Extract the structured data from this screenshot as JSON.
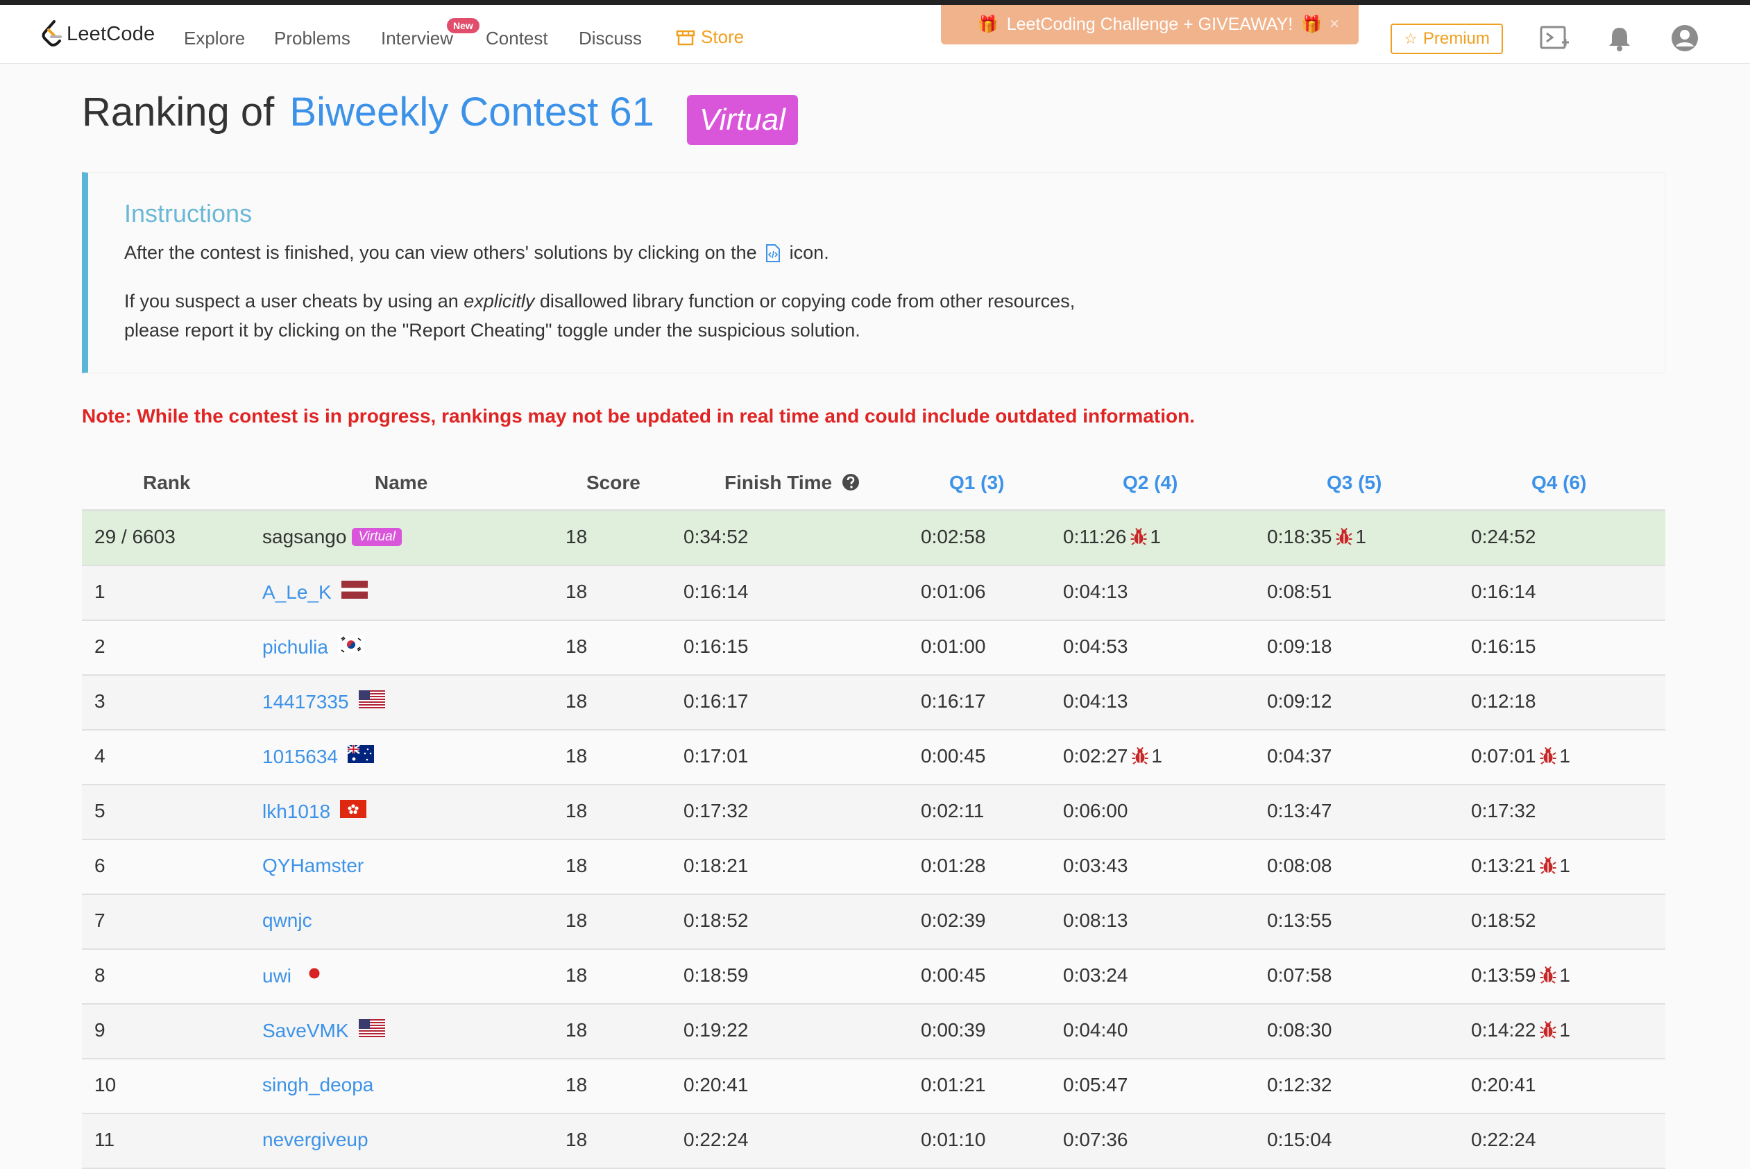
{
  "nav": {
    "brand": "LeetCode",
    "links": [
      "Explore",
      "Problems",
      "Interview",
      "Contest",
      "Discuss"
    ],
    "interview_badge": "New",
    "store": "Store",
    "promo": "LeetCoding Challenge + GIVEAWAY!",
    "promo_close": "×",
    "premium": "Premium"
  },
  "page": {
    "title_prefix": "Ranking of",
    "contest_name": "Biweekly Contest 61",
    "virtual_tag": "Virtual"
  },
  "instructions": {
    "title": "Instructions",
    "p1_before": "After the contest is finished, you can view others' solutions by clicking on the",
    "p1_after": "icon.",
    "p2_before": "If you suspect a user cheats by using an ",
    "p2_em": "explicitly",
    "p2_after": " disallowed library function or copying code from other resources,",
    "p3": "please report it by clicking on the \"Report Cheating\" toggle under the suspicious solution."
  },
  "note": "Note: While the contest is in progress, rankings may not be updated in real time and could include outdated information.",
  "table": {
    "headers": {
      "rank": "Rank",
      "name": "Name",
      "score": "Score",
      "finish": "Finish Time",
      "q1": "Q1 (3)",
      "q2": "Q2 (4)",
      "q3": "Q3 (5)",
      "q4": "Q4 (6)"
    },
    "rows": [
      {
        "rank": "29 / 6603",
        "name": "sagsango",
        "virtual": "Virtual",
        "flag": "",
        "score": "18",
        "finish": "0:34:52",
        "q1": "0:02:58",
        "q1_bug": "",
        "q2": "0:11:26",
        "q2_bug": "1",
        "q3": "0:18:35",
        "q3_bug": "1",
        "q4": "0:24:52",
        "q4_bug": ""
      },
      {
        "rank": "1",
        "name": "A_Le_K",
        "flag": "latvia",
        "score": "18",
        "finish": "0:16:14",
        "q1": "0:01:06",
        "q1_bug": "",
        "q2": "0:04:13",
        "q2_bug": "",
        "q3": "0:08:51",
        "q3_bug": "",
        "q4": "0:16:14",
        "q4_bug": ""
      },
      {
        "rank": "2",
        "name": "pichulia",
        "flag": "south-korea",
        "score": "18",
        "finish": "0:16:15",
        "q1": "0:01:00",
        "q1_bug": "",
        "q2": "0:04:53",
        "q2_bug": "",
        "q3": "0:09:18",
        "q3_bug": "",
        "q4": "0:16:15",
        "q4_bug": ""
      },
      {
        "rank": "3",
        "name": "14417335",
        "flag": "united-states",
        "score": "18",
        "finish": "0:16:17",
        "q1": "0:16:17",
        "q1_bug": "",
        "q2": "0:04:13",
        "q2_bug": "",
        "q3": "0:09:12",
        "q3_bug": "",
        "q4": "0:12:18",
        "q4_bug": ""
      },
      {
        "rank": "4",
        "name": "1015634",
        "flag": "australia",
        "score": "18",
        "finish": "0:17:01",
        "q1": "0:00:45",
        "q1_bug": "",
        "q2": "0:02:27",
        "q2_bug": "1",
        "q3": "0:04:37",
        "q3_bug": "",
        "q4": "0:07:01",
        "q4_bug": "1"
      },
      {
        "rank": "5",
        "name": "lkh1018",
        "flag": "hong-kong",
        "score": "18",
        "finish": "0:17:32",
        "q1": "0:02:11",
        "q1_bug": "",
        "q2": "0:06:00",
        "q2_bug": "",
        "q3": "0:13:47",
        "q3_bug": "",
        "q4": "0:17:32",
        "q4_bug": ""
      },
      {
        "rank": "6",
        "name": "QYHamster",
        "flag": "",
        "score": "18",
        "finish": "0:18:21",
        "q1": "0:01:28",
        "q1_bug": "",
        "q2": "0:03:43",
        "q2_bug": "",
        "q3": "0:08:08",
        "q3_bug": "",
        "q4": "0:13:21",
        "q4_bug": "1"
      },
      {
        "rank": "7",
        "name": "qwnjc",
        "flag": "",
        "score": "18",
        "finish": "0:18:52",
        "q1": "0:02:39",
        "q1_bug": "",
        "q2": "0:08:13",
        "q2_bug": "",
        "q3": "0:13:55",
        "q3_bug": "",
        "q4": "0:18:52",
        "q4_bug": ""
      },
      {
        "rank": "8",
        "name": "uwi",
        "flag": "japan",
        "score": "18",
        "finish": "0:18:59",
        "q1": "0:00:45",
        "q1_bug": "",
        "q2": "0:03:24",
        "q2_bug": "",
        "q3": "0:07:58",
        "q3_bug": "",
        "q4": "0:13:59",
        "q4_bug": "1"
      },
      {
        "rank": "9",
        "name": "SaveVMK",
        "flag": "united-states",
        "score": "18",
        "finish": "0:19:22",
        "q1": "0:00:39",
        "q1_bug": "",
        "q2": "0:04:40",
        "q2_bug": "",
        "q3": "0:08:30",
        "q3_bug": "",
        "q4": "0:14:22",
        "q4_bug": "1"
      },
      {
        "rank": "10",
        "name": "singh_deopa",
        "flag": "",
        "score": "18",
        "finish": "0:20:41",
        "q1": "0:01:21",
        "q1_bug": "",
        "q2": "0:05:47",
        "q2_bug": "",
        "q3": "0:12:32",
        "q3_bug": "",
        "q4": "0:20:41",
        "q4_bug": ""
      },
      {
        "rank": "11",
        "name": "nevergiveup",
        "flag": "",
        "score": "18",
        "finish": "0:22:24",
        "q1": "0:01:10",
        "q1_bug": "",
        "q2": "0:07:36",
        "q2_bug": "",
        "q3": "0:15:04",
        "q3_bug": "",
        "q4": "0:22:24",
        "q4_bug": ""
      }
    ]
  },
  "colors": {
    "accent": "#3c92e8",
    "virtual": "#d955d9",
    "note": "#e02424",
    "store": "#f0a020",
    "bug": "#c62828",
    "self_row": "#dfefdb"
  }
}
